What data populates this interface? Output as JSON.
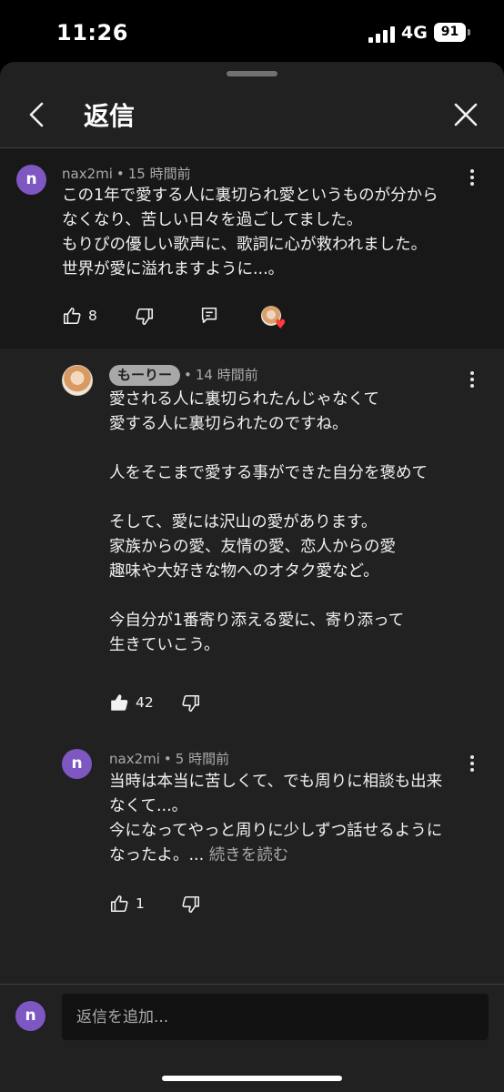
{
  "status": {
    "time": "11:26",
    "network": "4G",
    "battery": "91"
  },
  "header": {
    "title": "返信"
  },
  "parent_comment": {
    "avatar_letter": "n",
    "author": "nax2mi",
    "time": "15 時間前",
    "text": "この1年で愛する人に裏切られ愛というものが分から\nなくなり、苦しい日々を過ごしてました。\nもりぴの優しい歌声に、歌詞に心が救われました。\n世界が愛に溢れますように...。",
    "likes": "8"
  },
  "replies": [
    {
      "author": "もーりー",
      "time": "14 時間前",
      "text": "愛される人に裏切られたんじゃなくて\n愛する人に裏切られたのですね。\n\n人をそこまで愛する事ができた自分を褒めて\n\nそして、愛には沢山の愛があります。\n家族からの愛、友情の愛、恋人からの愛\n趣味や大好きな物へのオタク愛など。\n\n今自分が1番寄り添える愛に、寄り添って\n生きていこう。",
      "likes": "42"
    },
    {
      "avatar_letter": "n",
      "author": "nax2mi",
      "time": "5 時間前",
      "text": "当時は本当に苦しくて、でも周りに相談も出来\nなくて...。\n今になってやっと周りに少しずつ話せるように\nなったよ。...",
      "read_more": "続きを読む",
      "likes": "1"
    }
  ],
  "footer": {
    "avatar_letter": "n",
    "placeholder": "返信を追加..."
  },
  "colors": {
    "avatar_bg": "#7e57c2",
    "heart": "#ff3b3b",
    "sheet_bg": "#212121",
    "parent_bg": "#181818"
  },
  "icons": [
    "back-arrow-icon",
    "close-icon",
    "more-vert-icon",
    "thumb-up-icon",
    "thumb-down-icon",
    "reply-icon",
    "heart-icon"
  ]
}
